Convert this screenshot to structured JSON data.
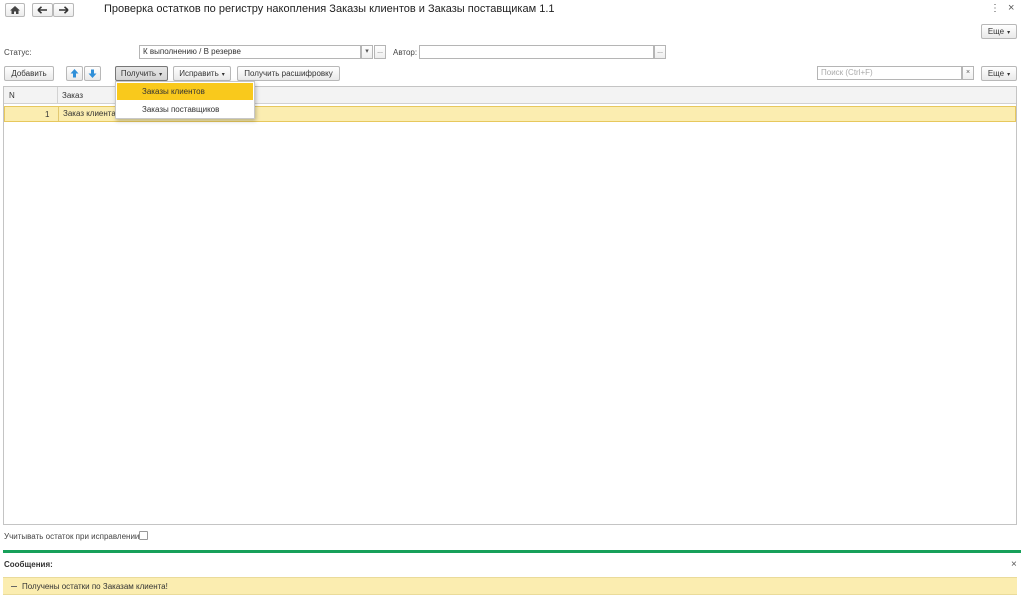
{
  "header": {
    "title": "Проверка остатков по регистру накопления Заказы клиентов и Заказы поставщикам 1.1",
    "more_label": "Еще",
    "menu_glyph": "⋮",
    "close_glyph": "×"
  },
  "filters": {
    "status_label": "Статус:",
    "status_value": "К выполнению / В резерве",
    "author_label": "Автор:",
    "author_value": "",
    "dropdown_glyph": "▾",
    "select_glyph": "..."
  },
  "toolbar": {
    "add_label": "Добавить",
    "get_label": "Получить",
    "fix_label": "Исправить",
    "decode_label": "Получить расшифровку",
    "search_placeholder": "Поиск (Ctrl+F)",
    "search_clear": "×",
    "more_label": "Еще",
    "up_icon": "arrow-up-icon",
    "down_icon": "arrow-down-icon"
  },
  "get_menu": {
    "items": [
      {
        "label": "Заказы клиентов",
        "selected": true
      },
      {
        "label": "Заказы поставщиков",
        "selected": false
      }
    ]
  },
  "table": {
    "columns": [
      "N",
      "Заказ"
    ],
    "rows": [
      {
        "n": "1",
        "order": "Заказ клиента"
      }
    ]
  },
  "options": {
    "account_label": "Учитывать остаток при исправлении:",
    "account_checked": false
  },
  "messages": {
    "title": "Сообщения:",
    "close_glyph": "×",
    "items": [
      {
        "text": "Получены остатки по Заказам клиента!"
      }
    ]
  },
  "colors": {
    "highlight": "#fbedb0",
    "menu_selected": "#f9c91c",
    "accent_line": "#17a05a"
  }
}
